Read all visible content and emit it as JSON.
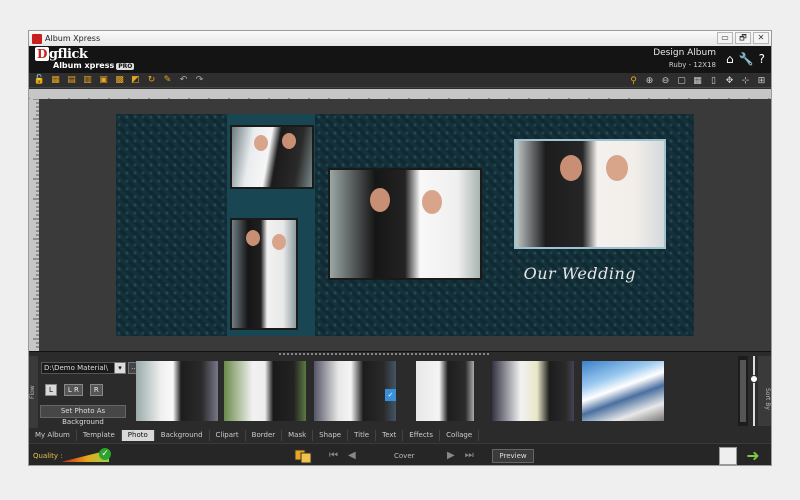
{
  "window": {
    "title": "Album Xpress",
    "controls": [
      "▭",
      "🗗",
      "✕"
    ]
  },
  "header": {
    "logo_d": "D",
    "logo_rest": "gflick",
    "product": "Album xpress",
    "pro_badge": "PRO",
    "design_title": "Design Album",
    "album_size": "Ruby - 12X18",
    "icons": [
      "home-icon",
      "wrench-icon",
      "help-icon"
    ]
  },
  "toolbar": {
    "left_icons": [
      "open-icon",
      "save-icon",
      "save-as-icon",
      "export-icon",
      "print-icon",
      "layout-icon",
      "arrange-icon",
      "rotate-icon",
      "auto-icon",
      "undo-icon",
      "redo-icon"
    ],
    "right_icons": [
      "pointer-icon",
      "zoom-in-icon",
      "zoom-out-icon",
      "frame-icon",
      "grid-icon",
      "columns-icon",
      "move-icon",
      "center-icon",
      "fit-icon"
    ]
  },
  "canvas": {
    "caption": "Our Wedding"
  },
  "bottom": {
    "flow_label": "Flow",
    "path_value": "D:\\Demo Material\\",
    "browse_label": "...",
    "lr_buttons": [
      "L",
      "L R",
      "R"
    ],
    "bg_button": "Set Photo As Background",
    "badge": "✓",
    "sort_label": "Sort By"
  },
  "tabs": [
    "My Album",
    "Template",
    "Photo",
    "Background",
    "Clipart",
    "Border",
    "Mask",
    "Shape",
    "Title",
    "Text",
    "Effects",
    "Collage"
  ],
  "active_tab": "Photo",
  "status": {
    "quality_label": "Quality :",
    "cover_label": "Cover",
    "preview_label": "Preview"
  },
  "colors": {
    "spread_bg": "#0f2a33",
    "panel_bg": "#184652",
    "active_tab": "#d9d9d9",
    "next_arrow": "#7ac943"
  }
}
